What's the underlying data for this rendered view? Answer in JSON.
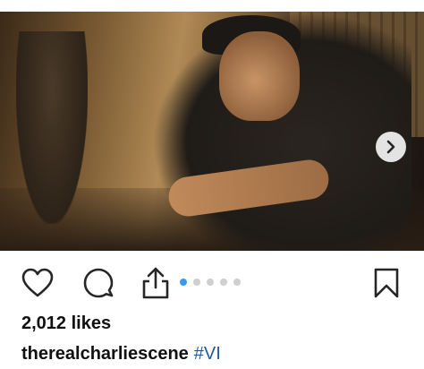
{
  "post": {
    "image_description_icon": "photo",
    "carousel": {
      "total": 5,
      "active_index": 0
    }
  },
  "actions": {
    "like_icon": "heart-outline-icon",
    "comment_icon": "comment-bubble-icon",
    "share_icon": "share-upload-icon",
    "save_icon": "bookmark-icon",
    "next_icon": "chevron-right-icon"
  },
  "likes_text": "2,012 likes",
  "caption": {
    "username": "therealcharliescene",
    "hashtag": "#VI"
  },
  "colors": {
    "accent": "#3897f0",
    "hashtag": "#1e5b9e",
    "text": "#111111"
  }
}
